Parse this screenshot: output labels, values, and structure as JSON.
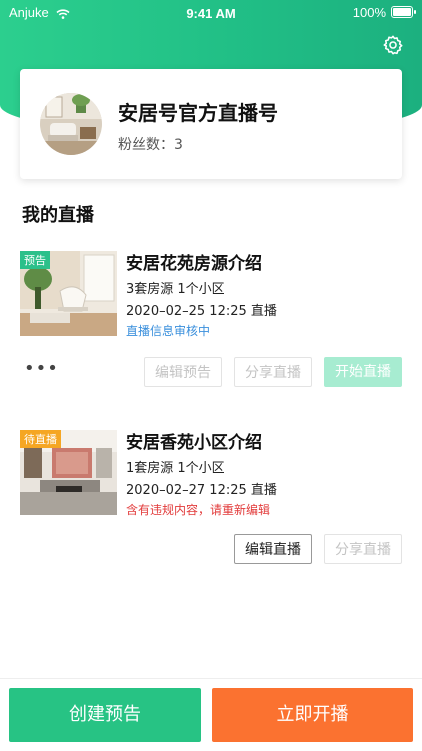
{
  "status_bar": {
    "carrier": "Anjuke",
    "time": "9:41 AM",
    "battery": "100%"
  },
  "profile": {
    "name": "安居号官方直播号",
    "fans_label": "粉丝数：",
    "fans_count": "3"
  },
  "section_title": "我的直播",
  "lives": [
    {
      "tag": "预告",
      "title": "安居花苑房源介绍",
      "meta": "3套房源  1个小区",
      "time": "2020–02–25  12:25 直播",
      "status": "直播信息审核中",
      "buttons": {
        "edit_preview": "编辑预告",
        "share": "分享直播",
        "start": "开始直播"
      },
      "more": "•••"
    },
    {
      "tag": "待直播",
      "title": "安居香苑小区介绍",
      "meta": "1套房源  1个小区",
      "time": "2020–02–27  12:25 直播",
      "status": "含有违规内容，请重新编辑",
      "buttons": {
        "edit_live": "编辑直播",
        "share": "分享直播"
      }
    }
  ],
  "bottom": {
    "create_preview": "创建预告",
    "go_live": "立即开播"
  },
  "colors": {
    "brand_green": "#27c384",
    "orange": "#fb7230",
    "status_blue": "#3a8fdc",
    "status_red": "#e23b3b"
  }
}
